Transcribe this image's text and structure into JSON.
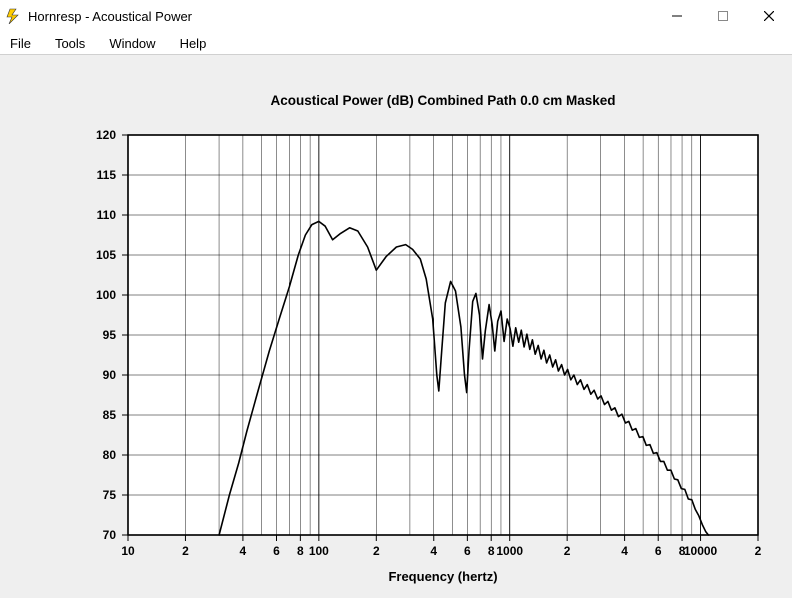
{
  "window": {
    "title": "Hornresp - Acoustical Power"
  },
  "menu": {
    "file": "File",
    "tools": "Tools",
    "window": "Window",
    "help": "Help"
  },
  "chart_data": {
    "type": "line",
    "title": "Acoustical Power (dB)    Combined    Path 0.0 cm    Masked",
    "xlabel": "Frequency (hertz)",
    "ylabel": "",
    "xscale": "log",
    "xlim": [
      10,
      20000
    ],
    "ylim": [
      70,
      120
    ],
    "x_ticks": [
      10,
      20,
      40,
      60,
      80,
      100,
      200,
      400,
      600,
      800,
      1000,
      2000,
      4000,
      6000,
      8000,
      10000,
      20000
    ],
    "x_tick_labels": [
      "10",
      "2",
      "4",
      "6",
      "8",
      "100",
      "2",
      "4",
      "6",
      "8",
      "1000",
      "2",
      "4",
      "6",
      "8",
      "10000",
      "2"
    ],
    "y_ticks": [
      70,
      75,
      80,
      85,
      90,
      95,
      100,
      105,
      110,
      115,
      120
    ],
    "series": [
      {
        "name": "Acoustical Power",
        "points": [
          [
            30,
            70
          ],
          [
            34,
            75
          ],
          [
            38,
            79
          ],
          [
            42,
            83
          ],
          [
            48,
            88
          ],
          [
            55,
            93
          ],
          [
            62,
            97
          ],
          [
            70,
            101
          ],
          [
            78,
            105
          ],
          [
            85,
            107.5
          ],
          [
            92,
            108.8
          ],
          [
            100,
            109.2
          ],
          [
            108,
            108.6
          ],
          [
            118,
            106.9
          ],
          [
            130,
            107.7
          ],
          [
            145,
            108.4
          ],
          [
            160,
            108
          ],
          [
            180,
            106
          ],
          [
            200,
            103.1
          ],
          [
            225,
            104.8
          ],
          [
            255,
            106
          ],
          [
            285,
            106.3
          ],
          [
            310,
            105.7
          ],
          [
            340,
            104.5
          ],
          [
            365,
            102
          ],
          [
            395,
            97
          ],
          [
            415,
            90
          ],
          [
            425,
            88
          ],
          [
            440,
            93
          ],
          [
            460,
            99
          ],
          [
            490,
            101.7
          ],
          [
            520,
            100.5
          ],
          [
            555,
            96
          ],
          [
            580,
            90
          ],
          [
            595,
            87.8
          ],
          [
            612,
            93
          ],
          [
            640,
            99.2
          ],
          [
            665,
            100.2
          ],
          [
            695,
            97.5
          ],
          [
            720,
            92
          ],
          [
            745,
            95.5
          ],
          [
            780,
            98.8
          ],
          [
            810,
            96.3
          ],
          [
            835,
            93
          ],
          [
            865,
            96.7
          ],
          [
            900,
            98
          ],
          [
            935,
            94.2
          ],
          [
            970,
            97
          ],
          [
            1005,
            95.8
          ],
          [
            1040,
            93.6
          ],
          [
            1075,
            95.9
          ],
          [
            1115,
            94.1
          ],
          [
            1150,
            95.6
          ],
          [
            1190,
            93.5
          ],
          [
            1230,
            95.1
          ],
          [
            1275,
            93.2
          ],
          [
            1315,
            94.4
          ],
          [
            1360,
            92.6
          ],
          [
            1410,
            93.7
          ],
          [
            1460,
            92
          ],
          [
            1510,
            93.1
          ],
          [
            1560,
            91.5
          ],
          [
            1620,
            92.5
          ],
          [
            1680,
            91
          ],
          [
            1740,
            91.9
          ],
          [
            1800,
            90.5
          ],
          [
            1870,
            91.3
          ],
          [
            1940,
            90
          ],
          [
            2010,
            90.7
          ],
          [
            2090,
            89.4
          ],
          [
            2170,
            90
          ],
          [
            2260,
            88.8
          ],
          [
            2350,
            89.4
          ],
          [
            2450,
            88.2
          ],
          [
            2550,
            88.8
          ],
          [
            2660,
            87.6
          ],
          [
            2770,
            88.1
          ],
          [
            2890,
            87
          ],
          [
            3010,
            87.4
          ],
          [
            3140,
            86.3
          ],
          [
            3270,
            86.7
          ],
          [
            3410,
            85.6
          ],
          [
            3560,
            85.9
          ],
          [
            3710,
            84.8
          ],
          [
            3870,
            85.1
          ],
          [
            4040,
            84
          ],
          [
            4210,
            84.2
          ],
          [
            4390,
            83.1
          ],
          [
            4580,
            83.3
          ],
          [
            4780,
            82.2
          ],
          [
            4990,
            82.3
          ],
          [
            5200,
            81.2
          ],
          [
            5430,
            81.3
          ],
          [
            5660,
            80.2
          ],
          [
            5900,
            80.3
          ],
          [
            6160,
            79.2
          ],
          [
            6420,
            79.2
          ],
          [
            6700,
            78.1
          ],
          [
            6990,
            78.1
          ],
          [
            7290,
            77
          ],
          [
            7600,
            76.9
          ],
          [
            7930,
            75.8
          ],
          [
            8270,
            75.7
          ],
          [
            8630,
            74.5
          ],
          [
            9000,
            74.4
          ],
          [
            9390,
            73.2
          ],
          [
            9790,
            72.4
          ],
          [
            10210,
            71.3
          ],
          [
            10650,
            70.4
          ],
          [
            11000,
            70
          ]
        ]
      }
    ]
  }
}
